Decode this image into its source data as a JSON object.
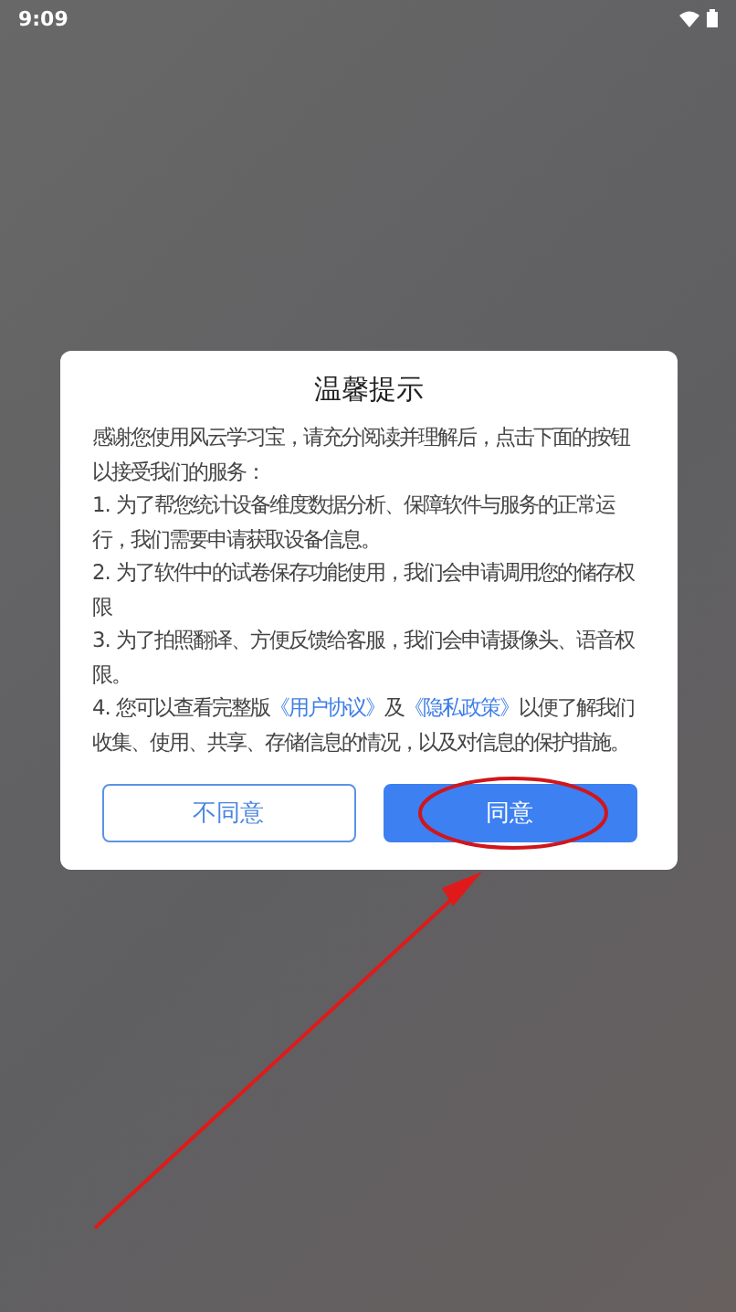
{
  "status_bar": {
    "time": "9:09"
  },
  "dialog": {
    "title": "温馨提示",
    "paragraphs": [
      [
        {
          "kind": "text",
          "text": "感谢您使用风云学习宝，请充分阅读并理解后，点击下面的按钮以接受我们的服务："
        }
      ],
      [
        {
          "kind": "text",
          "text": "1. 为了帮您统计设备维度数据分析、保障软件与服务的正常运行，我们需要申请获取设备信息。"
        }
      ],
      [
        {
          "kind": "text",
          "text": "2. 为了软件中的试卷保存功能使用，我们会申请调用您的储存权限"
        }
      ],
      [
        {
          "kind": "text",
          "text": "3. 为了拍照翻译、方便反馈给客服，我们会申请摄像头、语音权限。"
        }
      ],
      [
        {
          "kind": "text",
          "text": "4. 您可以查看完整版"
        },
        {
          "kind": "link",
          "text": "《用户协议》"
        },
        {
          "kind": "text",
          "text": "及"
        },
        {
          "kind": "link",
          "text": "《隐私政策》"
        },
        {
          "kind": "text",
          "text": "以便了解我们收集、使用、共享、存储信息的情况，以及对信息的保护措施。"
        }
      ]
    ],
    "buttons": [
      {
        "label": "不同意",
        "kind": "secondary"
      },
      {
        "label": "同意",
        "kind": "primary"
      }
    ]
  }
}
